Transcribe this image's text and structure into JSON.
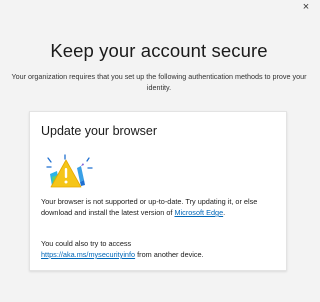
{
  "window": {
    "close_glyph": "×"
  },
  "header": {
    "title": "Keep your account secure",
    "subtitle": "Your organization requires that you set up the following authentication methods to prove your identity."
  },
  "card": {
    "title": "Update your browser",
    "illustration_icon": "browser-warning-icon",
    "message_part1": "Your browser is not supported or up-to-date. Try updating it, or else download and install the latest version of ",
    "edge_link": "Microsoft Edge",
    "message_part1_end": ".",
    "message2_part1": "You could also try to access ",
    "security_link": "https://aka.ms/mysecurityinfo",
    "message2_part2": " from another device."
  },
  "colors": {
    "background": "#f3f3f3",
    "card_background": "#ffffff",
    "link": "#0067b8",
    "warning": "#f5c518"
  }
}
